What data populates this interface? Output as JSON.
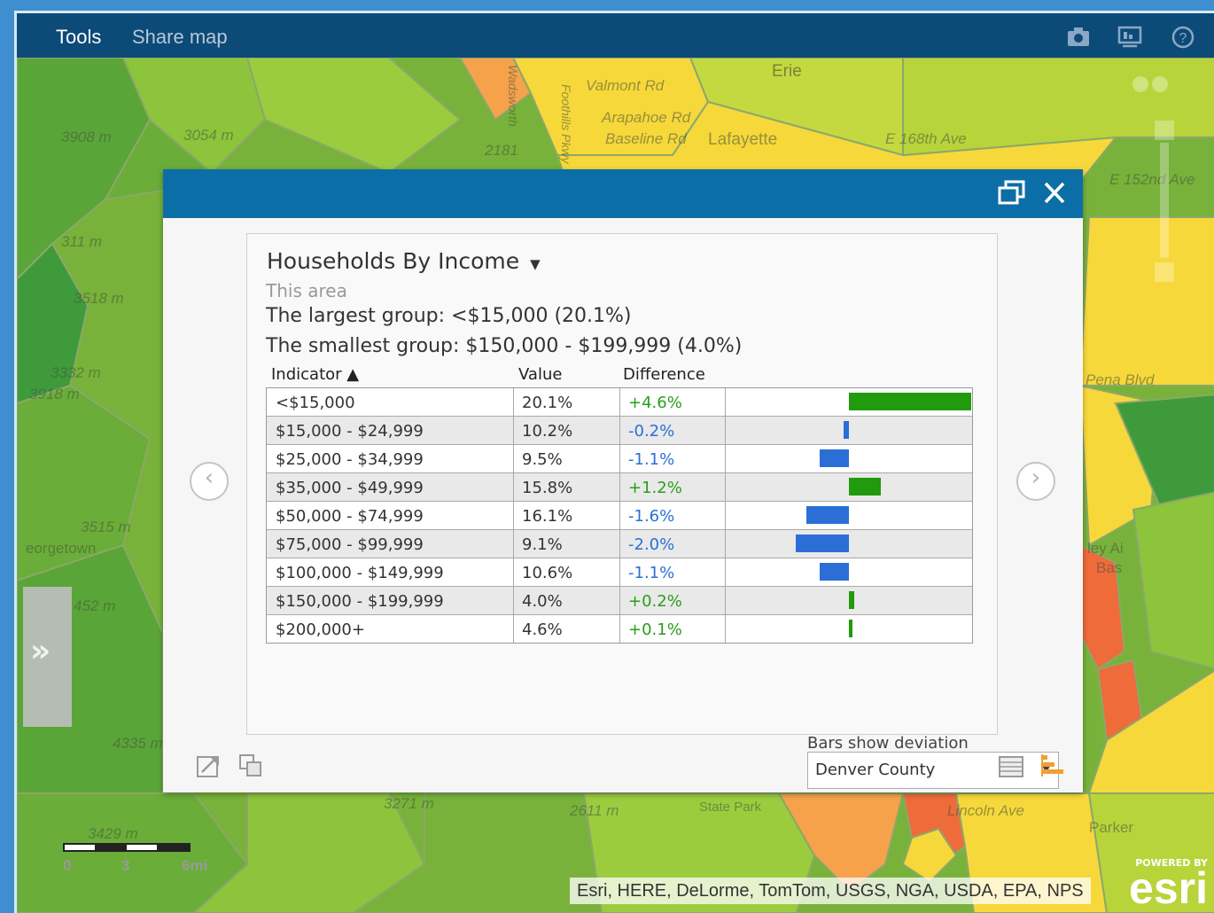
{
  "toolbar": {
    "tools_label": "Tools",
    "share_label": "Share map",
    "icons": [
      "camera-icon",
      "presentation-icon",
      "help-icon"
    ]
  },
  "map": {
    "labels": [
      "3908 m",
      "3054 m",
      "2181",
      "Erie",
      "Valmont Rd",
      "Arapahoe Rd",
      "Baseline Rd",
      "Lafayette",
      "E 168th Ave",
      "E 152nd Ave",
      "311 m",
      "3518 m",
      "3332 m",
      "3918 m",
      "3515 m",
      "eorgetown",
      "452 m",
      "4335 m",
      "3429 m",
      "3271 m",
      "2611 m",
      "State Park",
      "Lincoln Ave",
      "Parker",
      "Pena Blvd",
      "ley Ai",
      "Bas",
      "Foothills Pkwy",
      "Wadsworth"
    ],
    "scale": {
      "ticks": [
        "0",
        "3",
        "6mi"
      ]
    },
    "attribution": "Esri, HERE, DeLorme, TomTom, USGS, NGA, USDA, EPA, NPS",
    "powered_by": "POWERED BY",
    "esri_logo": "esri",
    "colors": {
      "green_dark": "#3f9a3c",
      "green": "#78b23a",
      "yellow_green": "#b8d43a",
      "yellow": "#f7d83a",
      "orange": "#f5a24a",
      "red_orange": "#ef6b3a"
    }
  },
  "panel": {
    "title": "Households By Income",
    "title_arrow": "▼",
    "subtitle": "This area",
    "largest": "The largest group: <$15,000 (20.1%)",
    "smallest": "The smallest group: $150,000 - $199,999 (4.0%)",
    "columns": {
      "indicator": "Indicator ▲",
      "value": "Value",
      "difference": "Difference"
    },
    "deviation_label": "Bars show deviation from",
    "deviation_select": "Denver County",
    "accent": "#0c6ea6",
    "bar_colors": {
      "positive": "#229a0e",
      "negative": "#2b6fd6"
    }
  },
  "chart_data": {
    "type": "bar",
    "categories": [
      "<$15,000",
      "$15,000 - $24,999",
      "$25,000 - $34,999",
      "$35,000 - $49,999",
      "$50,000 - $74,999",
      "$75,000 - $99,999",
      "$100,000 - $149,999",
      "$150,000 - $199,999",
      "$200,000+"
    ],
    "values_pct": [
      "20.1%",
      "10.2%",
      "9.5%",
      "15.8%",
      "16.1%",
      "9.1%",
      "10.6%",
      "4.0%",
      "4.6%"
    ],
    "difference_labels": [
      "+4.6%",
      "-0.2%",
      "-1.1%",
      "+1.2%",
      "-1.6%",
      "-2.0%",
      "-1.1%",
      "+0.2%",
      "+0.1%"
    ],
    "difference": [
      4.6,
      -0.2,
      -1.1,
      1.2,
      -1.6,
      -2.0,
      -1.1,
      0.2,
      0.1
    ]
  }
}
